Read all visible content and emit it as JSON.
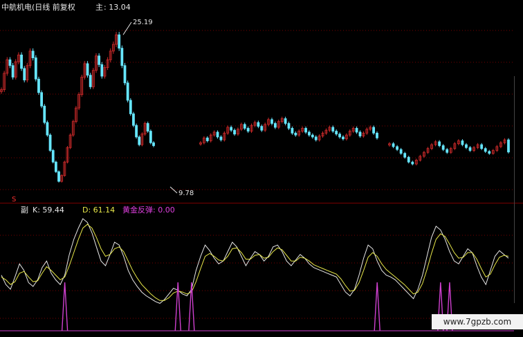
{
  "title": "中航机电(日线 前复权",
  "main_label": "主",
  "main_value": ": 13.04",
  "high_label": "25.19",
  "low_label": "9.78",
  "marker": "S",
  "sub_label": "副",
  "k_text": "K: 59.44",
  "d_text": "D: 61.14",
  "golden_text": "黄金反弹: 0.00",
  "watermark": "www.7gpzb.com",
  "colors": {
    "up": "#d02b2b",
    "down": "#66e6ff",
    "k": "#e8e8e8",
    "d": "#e8e84a",
    "signal": "#d040d0",
    "grid": "#7a0000"
  },
  "chart_data": [
    {
      "type": "candlestick",
      "description_free": true,
      "segments": [
        {
          "closes": [
            19.5,
            21.2,
            22.6,
            22.0,
            20.8,
            22.4,
            23.1,
            21.7,
            20.5,
            22.0,
            23.5,
            22.8,
            20.6,
            19.2,
            17.8,
            16.1,
            14.8,
            13.2,
            12.0,
            11.0,
            10.0,
            10.6,
            12.0,
            13.5,
            14.8,
            16.2,
            17.6,
            19.0,
            20.8,
            22.2,
            21.0,
            19.8,
            21.5,
            23.0,
            22.1,
            20.9,
            21.8,
            22.6,
            23.5,
            24.2,
            25.19,
            23.8,
            22.0,
            20.2,
            18.4,
            17.0,
            15.8,
            14.6,
            13.8,
            14.9,
            16.0,
            15.2,
            14.0,
            13.7
          ]
        },
        {
          "closes": [
            14.0,
            14.5,
            14.2,
            14.8,
            15.1,
            14.6,
            14.3,
            15.0,
            15.6,
            15.3,
            14.9,
            15.4,
            15.9,
            15.5,
            15.2,
            15.8,
            16.1,
            15.7,
            15.3,
            15.9,
            16.4,
            16.0,
            15.6,
            16.2,
            16.5,
            16.0,
            15.5,
            15.0,
            14.8,
            15.2,
            15.5,
            15.1,
            14.8,
            14.6,
            14.3,
            14.7,
            15.0,
            15.3,
            15.6,
            15.2,
            14.9,
            14.6,
            14.4,
            14.8,
            15.2,
            15.5,
            15.1,
            14.7,
            15.0,
            15.4,
            15.6,
            15.0,
            14.5
          ]
        },
        {
          "closes": [
            13.9,
            13.6,
            13.3,
            12.9,
            12.5,
            12.0,
            11.8,
            12.2,
            12.6,
            13.0,
            13.4,
            13.8,
            14.1,
            13.7,
            13.3,
            13.0,
            13.4,
            13.9,
            14.2,
            13.8,
            13.5,
            13.2,
            13.5,
            13.8,
            13.4,
            13.1,
            12.9,
            13.2,
            13.6,
            14.0,
            14.3,
            13.04
          ]
        }
      ],
      "high_value": 25.19,
      "low_value": 9.78,
      "last_value": 13.04
    },
    {
      "type": "line",
      "series": [
        {
          "name": "K",
          "values": [
            40,
            30,
            25,
            38,
            52,
            45,
            32,
            28,
            35,
            48,
            55,
            42,
            35,
            30,
            40,
            62,
            78,
            90,
            100,
            96,
            85,
            70,
            55,
            50,
            62,
            75,
            72,
            60,
            45,
            35,
            28,
            22,
            18,
            15,
            12,
            10,
            14,
            20,
            26,
            24,
            20,
            18,
            25,
            45,
            60,
            72,
            66,
            58,
            52,
            55,
            65,
            75,
            70,
            60,
            50,
            58,
            65,
            62,
            55,
            60,
            70,
            72,
            65,
            55,
            50,
            56,
            62,
            58,
            52,
            48,
            46,
            44,
            42,
            40,
            38,
            30,
            22,
            18,
            25,
            40,
            58,
            72,
            68,
            55,
            45,
            40,
            38,
            35,
            30,
            25,
            20,
            15,
            25,
            40,
            60,
            80,
            92,
            88,
            78,
            65,
            55,
            52,
            60,
            68,
            64,
            50,
            38,
            30,
            45,
            60,
            66,
            62,
            58
          ]
        },
        {
          "name": "D",
          "values": [
            38,
            35,
            30,
            33,
            42,
            44,
            38,
            33,
            34,
            42,
            49,
            45,
            40,
            35,
            38,
            50,
            64,
            78,
            90,
            94,
            90,
            80,
            68,
            60,
            62,
            68,
            70,
            65,
            55,
            45,
            37,
            30,
            25,
            20,
            16,
            13,
            13,
            16,
            21,
            23,
            22,
            20,
            22,
            33,
            47,
            60,
            63,
            60,
            56,
            55,
            60,
            68,
            69,
            64,
            57,
            57,
            61,
            62,
            58,
            59,
            65,
            69,
            67,
            61,
            55,
            55,
            59,
            58,
            55,
            51,
            49,
            47,
            45,
            43,
            41,
            36,
            29,
            23,
            24,
            32,
            45,
            59,
            64,
            60,
            52,
            46,
            42,
            38,
            34,
            30,
            25,
            20,
            22,
            31,
            46,
            63,
            78,
            84,
            81,
            73,
            64,
            58,
            59,
            64,
            64,
            57,
            47,
            38,
            41,
            51,
            59,
            61,
            60
          ]
        }
      ],
      "signal_spikes": [
        14,
        39,
        42,
        83,
        97,
        99
      ]
    }
  ]
}
